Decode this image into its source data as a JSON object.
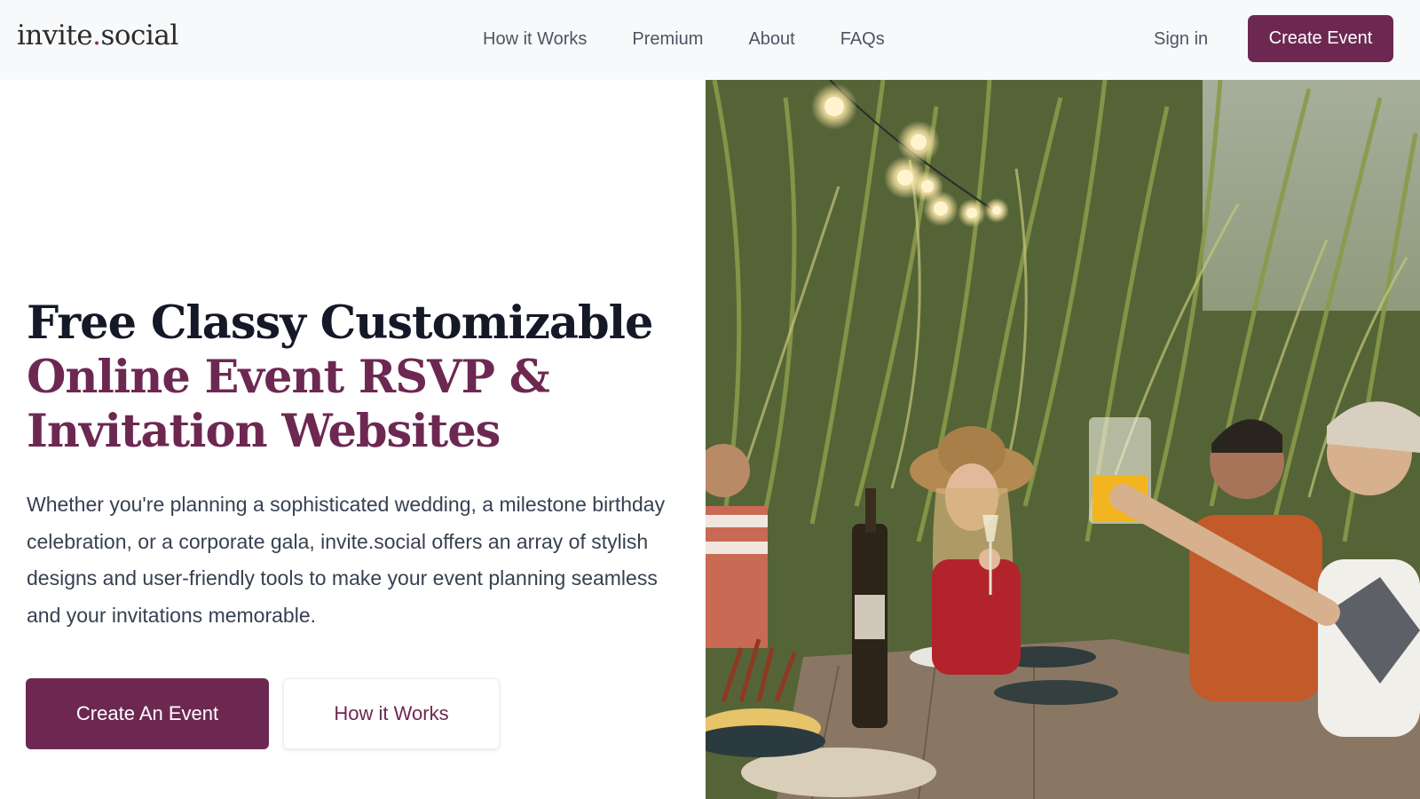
{
  "header": {
    "logo_part1": "invite",
    "logo_dot": ".",
    "logo_part2": "social",
    "nav": [
      {
        "label": "How it Works"
      },
      {
        "label": "Premium"
      },
      {
        "label": "About"
      },
      {
        "label": "FAQs"
      }
    ],
    "signin_label": "Sign in",
    "create_label": "Create Event"
  },
  "hero": {
    "headline_line1": "Free Classy Customizable",
    "headline_line2": "Online Event RSVP &",
    "headline_line3": "Invitation Websites",
    "description": "Whether you're planning a sophisticated wedding, a milestone birthday celebration, or a corporate gala, invite.social offers an array of stylish designs and user-friendly tools to make your event planning seamless and your invitations memorable.",
    "primary_button": "Create An Event",
    "secondary_button": "How it Works"
  },
  "colors": {
    "brand": "#6d2852",
    "logo_dot": "#8b2f62",
    "header_bg": "#f8f9fa",
    "headline_dark": "#141827"
  },
  "photo": {
    "icon": "party-photo"
  }
}
